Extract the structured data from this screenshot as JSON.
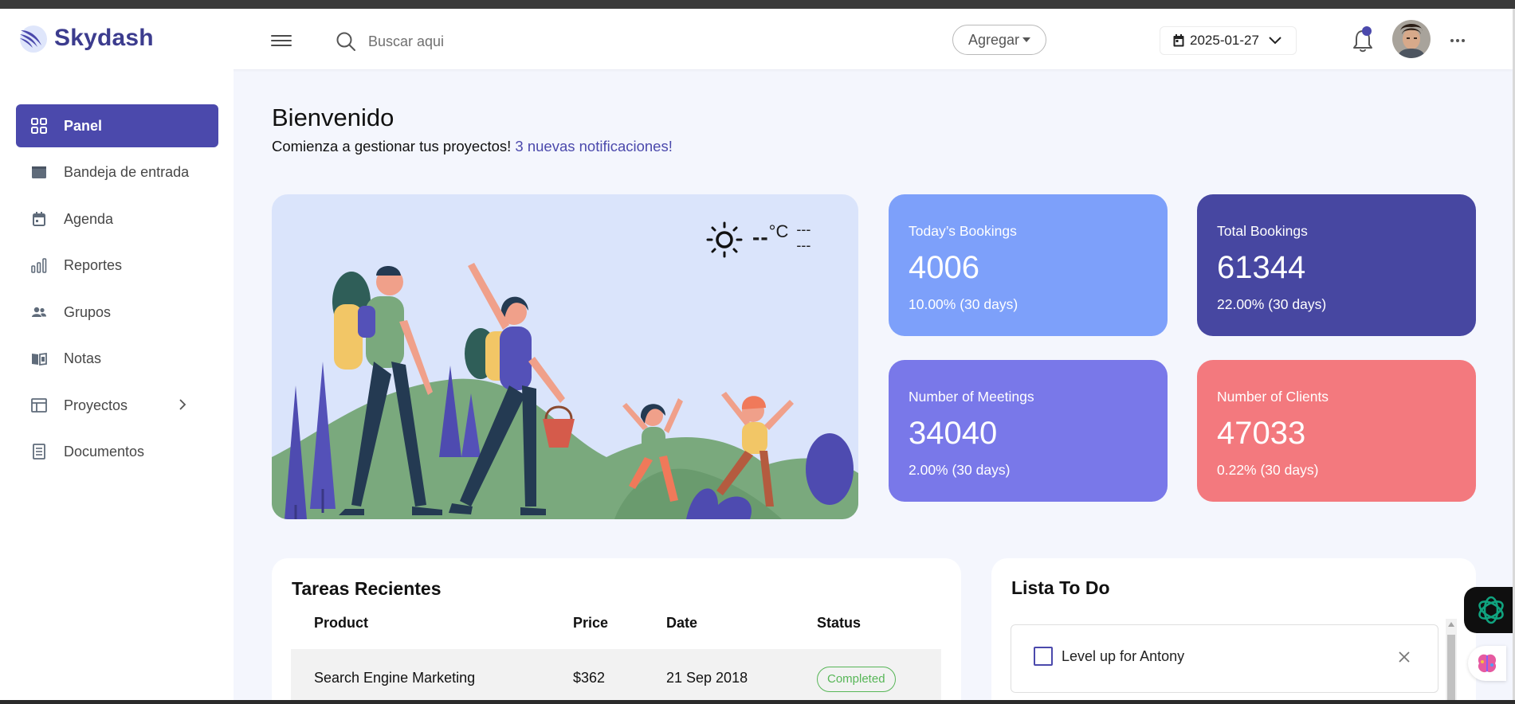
{
  "brand": {
    "name": "Skydash",
    "color": "#3c3c8e"
  },
  "search": {
    "placeholder": "Buscar aqui"
  },
  "header": {
    "add_label": "Agregar",
    "date": "2025-01-27",
    "icons": [
      "menu-icon",
      "search-icon",
      "calendar-icon",
      "chevron-down-icon",
      "bell-icon",
      "more-icon"
    ]
  },
  "sidebar": {
    "items": [
      {
        "label": "Panel",
        "icon": "grid-icon",
        "active": true
      },
      {
        "label": "Bandeja de entrada",
        "icon": "inbox-icon"
      },
      {
        "label": "Agenda",
        "icon": "calendar-icon"
      },
      {
        "label": "Reportes",
        "icon": "chart-icon"
      },
      {
        "label": "Grupos",
        "icon": "people-icon"
      },
      {
        "label": "Notas",
        "icon": "book-icon"
      },
      {
        "label": "Proyectos",
        "icon": "layout-icon",
        "has_submenu": true
      },
      {
        "label": "Documentos",
        "icon": "document-icon"
      }
    ]
  },
  "welcome": {
    "title": "Bienvenido",
    "subtitle": "Comienza a gestionar tus proyectos!",
    "notifications": "3 nuevas notificaciones!"
  },
  "weather": {
    "temp": "--",
    "unit": "°C",
    "location_line1": "---",
    "location_line2": "---"
  },
  "stats": [
    {
      "label": "Today’s Bookings",
      "value": "4006",
      "change": "10.00% (30 days)",
      "color": "#7da0fa"
    },
    {
      "label": "Total Bookings",
      "value": "61344",
      "change": "22.00% (30 days)",
      "color": "#4747a1"
    },
    {
      "label": "Number of Meetings",
      "value": "34040",
      "change": "2.00% (30 days)",
      "color": "#7978e9"
    },
    {
      "label": "Number of Clients",
      "value": "47033",
      "change": "0.22% (30 days)",
      "color": "#f3797e"
    }
  ],
  "tasks": {
    "title": "Tareas Recientes",
    "columns": [
      "Product",
      "Price",
      "Date",
      "Status"
    ],
    "rows": [
      {
        "product": "Search Engine Marketing",
        "price": "$362",
        "date": "21 Sep 2018",
        "status": "Completed"
      }
    ]
  },
  "todo": {
    "title": "Lista To Do",
    "items": [
      {
        "text": "Level up for Antony",
        "done": false
      }
    ]
  },
  "colors": {
    "accent": "#4b49ac",
    "background": "#f4f6fd",
    "success": "#57b657"
  }
}
